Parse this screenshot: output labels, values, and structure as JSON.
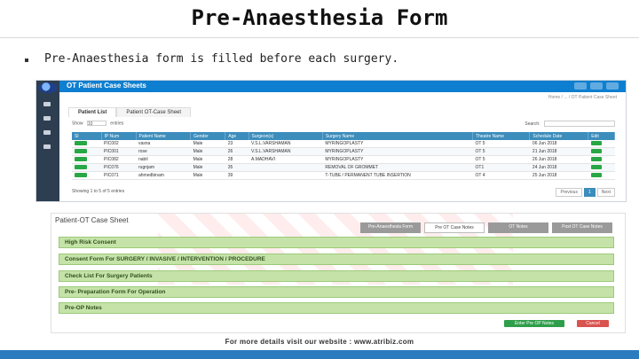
{
  "slide": {
    "title": "Pre-Anaesthesia Form",
    "bullet": "Pre-Anaesthesia form is filled before each surgery."
  },
  "ot_screen": {
    "header_title": "OT Patient Case Sheets",
    "breadcrumb": "Home / ... / OT Patient Case Sheet",
    "tabs": [
      "Patient List",
      "Patient OT-Case Sheet"
    ],
    "show_label": "Show",
    "show_value": "10",
    "entries_label": "entries",
    "search_label": "Search:",
    "columns": [
      "Sl",
      "IP Num",
      "Patient Name",
      "Gender",
      "Age",
      "Surgeon(s)",
      "Surgery Name",
      "Theatre Name",
      "Schedule Date",
      "Edit"
    ],
    "rows": [
      {
        "ip": "PIC002",
        "name": "vasna",
        "gender": "Male",
        "age": "23",
        "surgeon": "V.S.L.VARSHAMAN",
        "surgery": "MYRINGOPLASTY",
        "theatre": "OT 5",
        "date": "06 Jun 2018"
      },
      {
        "ip": "PIC001",
        "name": "rose",
        "gender": "Male",
        "age": "26",
        "surgeon": "V.S.L.VARSHAMAN",
        "surgery": "MYRINGOPLASTY",
        "theatre": "OT 5",
        "date": "21 Jun 2018"
      },
      {
        "ip": "PIC082",
        "name": "nabil",
        "gender": "Male",
        "age": "28",
        "surgeon": "A.MADHAVI",
        "surgery": "MYRINGOPLASTY",
        "theatre": "OT 5",
        "date": "26 Jun 2018"
      },
      {
        "ip": "PIC076",
        "name": "rugnjam",
        "gender": "Male",
        "age": "35",
        "surgeon": "",
        "surgery": "REMOVAL OF GROMMET",
        "theatre": "OT1",
        "date": "24 Jun 2018"
      },
      {
        "ip": "PIC071",
        "name": "ahmedbinam",
        "gender": "Male",
        "age": "39",
        "surgeon": "",
        "surgery": "T-TUBE / PERMANENT TUBE INSERTION",
        "theatre": "OT 4",
        "date": "25 Jun 2018"
      }
    ],
    "showing_text": "Showing 1 to 5 of 5 entries",
    "pager": {
      "prev": "Previous",
      "page": "1",
      "next": "Next"
    }
  },
  "case_sheet": {
    "title": "Patient-OT Case Sheet",
    "tabs": [
      "Pre-Anaesthesia Form",
      "Pre OT Case Notes",
      "OT Notes",
      "Post OT Case Notes"
    ],
    "active_tab_index": 1,
    "sections": [
      "High Risk Consent",
      "Consent Form For SURGERY / INVASIVE / INTERVENTION / PROCEDURE",
      "Check List For Surgery Patients",
      "Pre- Preparation Form For Operation",
      "Pre-OP Notes"
    ],
    "enter_button": "Enter Pre OP Notes",
    "cancel_button": "Cancel"
  },
  "footer": {
    "text": "For more details visit our website : www.atribiz.com"
  },
  "colors": {
    "topbar": "#0e7fd0",
    "table_header": "#3c8dbc",
    "section_green": "#c5e3a8",
    "bottom_bar": "#2b7bbf"
  }
}
